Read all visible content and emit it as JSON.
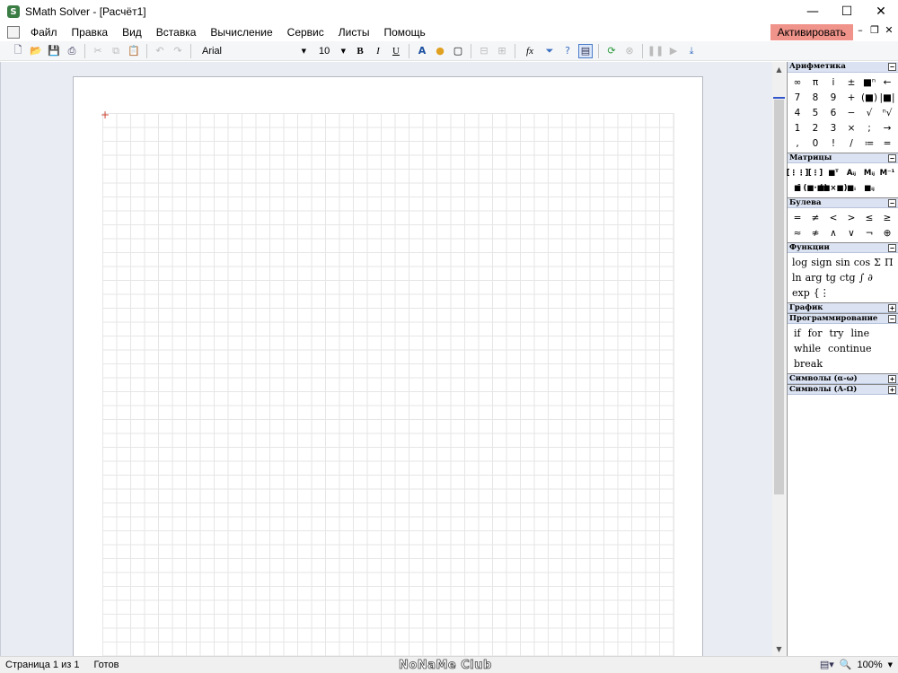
{
  "window": {
    "title": "SMath Solver - [Расчёт1]",
    "app_icon_letter": "S",
    "minimize": "—",
    "maximize": "☐",
    "close": "✕"
  },
  "menu": {
    "items": [
      "Файл",
      "Правка",
      "Вид",
      "Вставка",
      "Вычисление",
      "Сервис",
      "Листы",
      "Помощь"
    ],
    "activate_label": "Активировать",
    "mdi_controls": [
      "–",
      "❐",
      "✕"
    ]
  },
  "toolbar": {
    "font_name": "Arial",
    "font_size": "10",
    "bold": "B",
    "italic": "I",
    "underline": "U",
    "fx": "fx"
  },
  "document": {
    "cursor_glyph": "+"
  },
  "panel": {
    "arithmetic": {
      "title": "Арифметика",
      "toggle": "−",
      "cells": [
        "∞",
        "π",
        "i",
        "±",
        "■ⁿ",
        "←",
        "7",
        "8",
        "9",
        "+",
        "(■)",
        "|■|",
        "4",
        "5",
        "6",
        "−",
        "√",
        "ⁿ√",
        "1",
        "2",
        "3",
        "×",
        ";",
        "→",
        ",",
        "0",
        "!",
        "/",
        "≔",
        "="
      ]
    },
    "matrices": {
      "title": "Матрицы",
      "toggle": "−",
      "cells": [
        "[⋮⋮]",
        "[⋮]",
        "■ᵀ",
        "Aᵢⱼ",
        "Mᵢⱼ",
        "M⁻¹",
        "■̄",
        "(■·■)",
        "(■×■)",
        "■ᵢ",
        "■ᵢⱼ"
      ]
    },
    "boolean": {
      "title": "Булева",
      "toggle": "−",
      "cells": [
        "=",
        "≠",
        "<",
        ">",
        "≤",
        "≥",
        "≈",
        "≉",
        "∧",
        "∨",
        "¬",
        "⊕"
      ]
    },
    "functions": {
      "title": "Функции",
      "toggle": "−",
      "words": [
        "log",
        "sign",
        "sin",
        "cos",
        "Σ",
        "Π",
        "ln",
        "arg",
        "tg",
        "ctg",
        "∫",
        "∂",
        "exp",
        "{⋮"
      ]
    },
    "graph": {
      "title": "График",
      "toggle": "+"
    },
    "programming": {
      "title": "Программирование",
      "toggle": "−",
      "words": [
        "if",
        "for",
        "try",
        "line",
        "while",
        "continue",
        "break"
      ]
    },
    "symbols_lower": {
      "title": "Символы (α-ω)",
      "toggle": "+"
    },
    "symbols_upper": {
      "title": "Символы (Α-Ω)",
      "toggle": "+"
    }
  },
  "status": {
    "page": "Страница 1 из 1",
    "state": "Готов",
    "watermark": "NoNaMe Club",
    "zoom": "100%"
  },
  "scrollbar": {
    "up": "▲",
    "down": "▼"
  }
}
